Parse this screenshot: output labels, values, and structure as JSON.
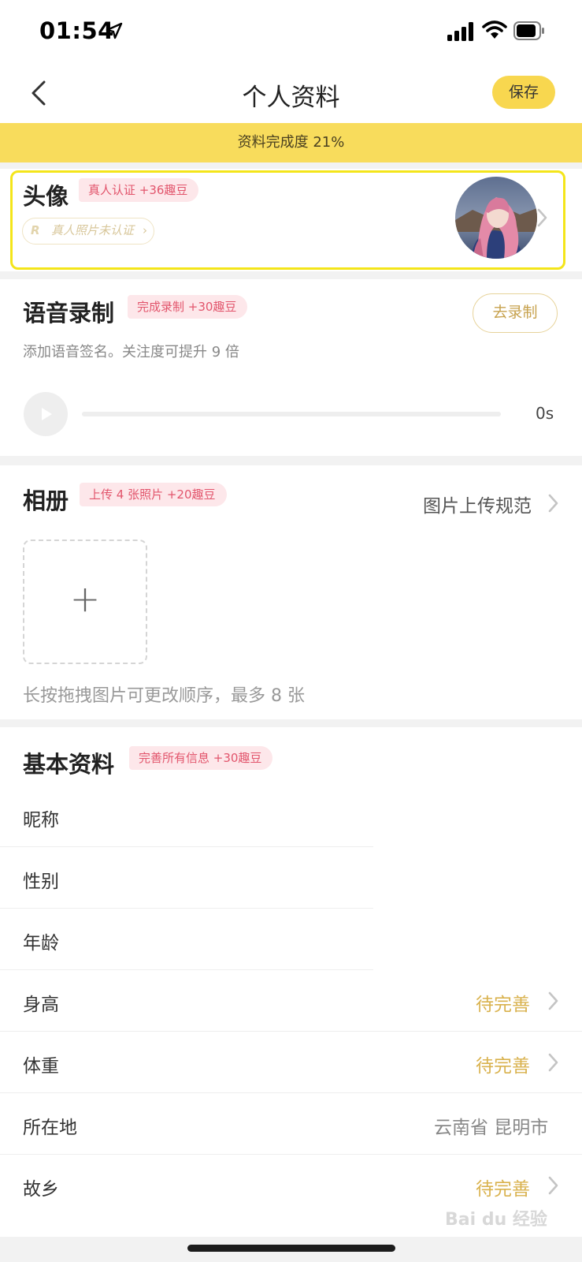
{
  "status_bar": {
    "time": "01:54"
  },
  "nav": {
    "title": "个人资料",
    "save_label": "保存"
  },
  "completion": {
    "text": "资料完成度 21%",
    "percent": 21
  },
  "avatar_section": {
    "title": "头像",
    "reward": "真人认证 +36趣豆",
    "verify_mark": "R",
    "verify_label": "真人照片未认证",
    "verify_chevron": "›"
  },
  "voice_section": {
    "title": "语音录制",
    "reward": "完成录制 +30趣豆",
    "subtitle": "添加语音签名。关注度可提升 9 倍",
    "record_label": "去录制",
    "duration": "0s"
  },
  "album_section": {
    "title": "相册",
    "reward": "上传 4 张照片 +20趣豆",
    "guide_link": "图片上传规范",
    "add_symbol": "+",
    "hint": "长按拖拽图片可更改顺序，最多 8 张"
  },
  "basic_section": {
    "title": "基本资料",
    "reward": "完善所有信息 +30趣豆",
    "rows": [
      {
        "label": "昵称",
        "value": ""
      },
      {
        "label": "性别",
        "value": ""
      },
      {
        "label": "年龄",
        "value": ""
      },
      {
        "label": "身高",
        "value": "待完善"
      },
      {
        "label": "体重",
        "value": "待完善"
      },
      {
        "label": "所在地",
        "value": "云南省 昆明市"
      },
      {
        "label": "故乡",
        "value": "待完善"
      }
    ]
  },
  "watermark": "Bai du 经验",
  "colors": {
    "accent": "#f8d74f",
    "banner": "#f8dc5c",
    "pending": "#d9b24e",
    "tag_text": "#e2556c",
    "tag_bg": "#fde7ea"
  }
}
